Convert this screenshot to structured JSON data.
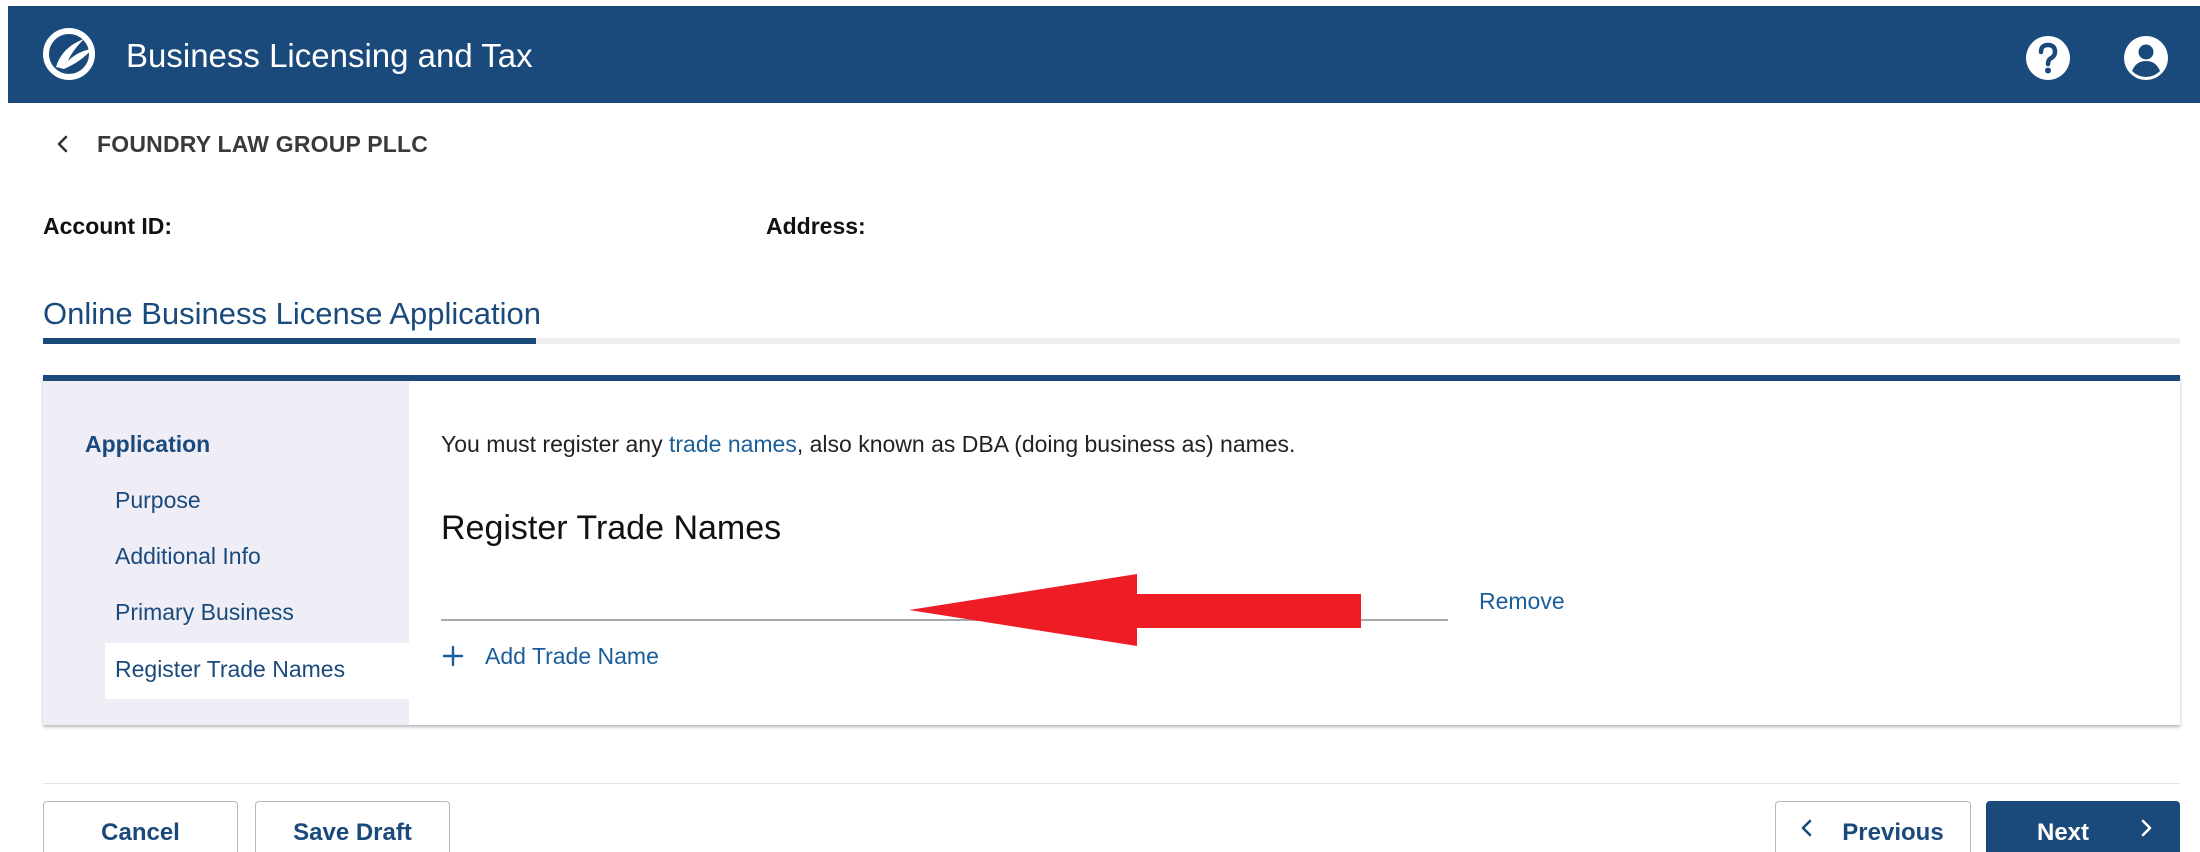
{
  "header": {
    "app_title": "Business Licensing and Tax",
    "logo_icon": "brand-logo-icon",
    "help_icon": "help-icon",
    "account_icon": "account-icon",
    "brand_color": "#1a4a7c"
  },
  "breadcrumb": {
    "back_icon": "chevron-left-icon",
    "label": "FOUNDRY LAW GROUP PLLC"
  },
  "account_info": {
    "account_id_label": "Account ID:",
    "address_label": "Address:"
  },
  "page_tab": {
    "label": "Online Business License Application"
  },
  "sidebar": {
    "heading": "Application",
    "items": [
      {
        "label": "Purpose",
        "active": false
      },
      {
        "label": "Additional Info",
        "active": false
      },
      {
        "label": "Primary Business",
        "active": false
      },
      {
        "label": "Register Trade Names",
        "active": true
      }
    ]
  },
  "main": {
    "intro_before": "You must register any ",
    "intro_link": "trade names",
    "intro_after": ", also known as DBA (doing business as) names.",
    "section_title": "Register Trade Names",
    "trade_name_value": "",
    "remove_label": "Remove",
    "add_icon": "plus-icon",
    "add_label": "Add Trade Name",
    "annotation_icon": "red-arrow-annotation-icon",
    "annotation_color": "#ee1c25"
  },
  "footer": {
    "cancel_label": "Cancel",
    "save_draft_label": "Save Draft",
    "previous_label": "Previous",
    "next_label": "Next"
  }
}
